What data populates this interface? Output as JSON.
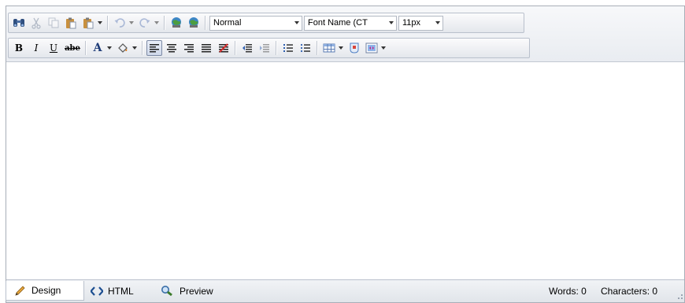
{
  "toolbar": {
    "style_combo": {
      "value": "Normal"
    },
    "font_combo": {
      "value": "Font Name (CT"
    },
    "size_combo": {
      "value": "11px"
    },
    "bold_label": "B",
    "italic_label": "I",
    "underline_label": "U",
    "strike_label": "abe",
    "font_color_label": "A"
  },
  "icons": {
    "row1": [
      "find-icon",
      "cut-icon",
      "copy-icon",
      "paste-icon",
      "paste-options-icon",
      "undo-icon",
      "redo-icon",
      "hyperlink-icon",
      "remove-link-icon"
    ],
    "row2": [
      "bold-icon",
      "italic-icon",
      "underline-icon",
      "strikethrough-icon",
      "font-color-icon",
      "highlight-color-icon",
      "align-left-icon",
      "align-center-icon",
      "align-right-icon",
      "justify-icon",
      "clear-formatting-icon",
      "outdent-icon",
      "indent-icon",
      "numbered-list-icon",
      "bulleted-list-icon",
      "insert-table-icon",
      "insert-image-icon",
      "insert-media-icon"
    ]
  },
  "status_bar": {
    "tabs": [
      {
        "label": "Design",
        "icon": "pencil-icon",
        "active": true
      },
      {
        "label": "HTML",
        "icon": "code-brackets-icon",
        "active": false
      },
      {
        "label": "Preview",
        "icon": "magnifier-icon",
        "active": false
      }
    ],
    "words_label": "Words: 0",
    "characters_label": "Characters: 0"
  },
  "colors": {
    "border": "#a8aeb8",
    "toolbar_bg": "#e9ecf1",
    "active_button": "#cfd8ea"
  }
}
